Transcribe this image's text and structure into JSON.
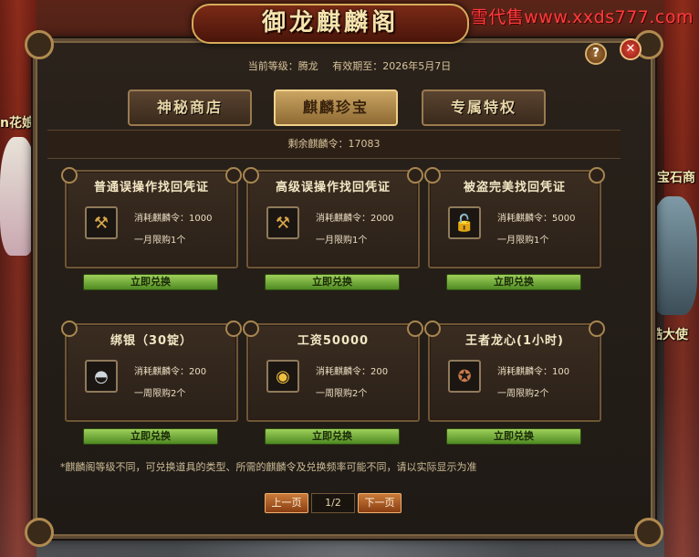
{
  "watermark": "小雪代售www.xxds777.com",
  "scene": {
    "npc_left": "n花娘",
    "npc_right_top": "宝石商",
    "npc_right_mid": "酷大使"
  },
  "window": {
    "title": "御龙麒麟阁",
    "help_label": "?",
    "close_label": "✕"
  },
  "info": {
    "level": "当前等级：腾龙",
    "expiry": "有效期至：2026年5月7日"
  },
  "tabs": [
    {
      "label": "神秘商店",
      "active": false
    },
    {
      "label": "麒麟珍宝",
      "active": true
    },
    {
      "label": "专属特权",
      "active": false
    }
  ],
  "remaining": "剩余麒麟令：17083",
  "items": [
    {
      "name": "普通误操作找回凭证",
      "icon": "hammer-icon",
      "cost_label": "消耗麒麟令：",
      "cost": "1000",
      "limit": "一月限购1个",
      "button": "立即兑换"
    },
    {
      "name": "高级误操作找回凭证",
      "icon": "hammer-icon",
      "cost_label": "消耗麒麟令：",
      "cost": "2000",
      "limit": "一月限购1个",
      "button": "立即兑换"
    },
    {
      "name": "被盗完美找回凭证",
      "icon": "lock-icon",
      "cost_label": "消耗麒麟令：",
      "cost": "5000",
      "limit": "一月限购1个",
      "button": "立即兑换"
    },
    {
      "name": "绑银（30锭）",
      "icon": "silver-ingot-icon",
      "cost_label": "消耗麒麟令：",
      "cost": "200",
      "limit": "一周限购2个",
      "button": "立即兑换"
    },
    {
      "name": "工资50000",
      "icon": "gold-coins-icon",
      "cost_label": "消耗麒麟令：",
      "cost": "200",
      "limit": "一周限购2个",
      "button": "立即兑换"
    },
    {
      "name": "王者龙心(1小时)",
      "icon": "dragon-heart-icon",
      "cost_label": "消耗麒麟令：",
      "cost": "100",
      "limit": "一周限购2个",
      "button": "立即兑换"
    }
  ],
  "footnote": "*麒麟阁等级不同，可兑换道具的类型、所需的麒麟令及兑换频率可能不同，请以实际显示为准",
  "pager": {
    "prev": "上一页",
    "page": "1/2",
    "next": "下一页"
  },
  "colors": {
    "accent_gold": "#d6ab5a",
    "button_green": "#7fb540",
    "panel_brown": "#2b2119"
  }
}
